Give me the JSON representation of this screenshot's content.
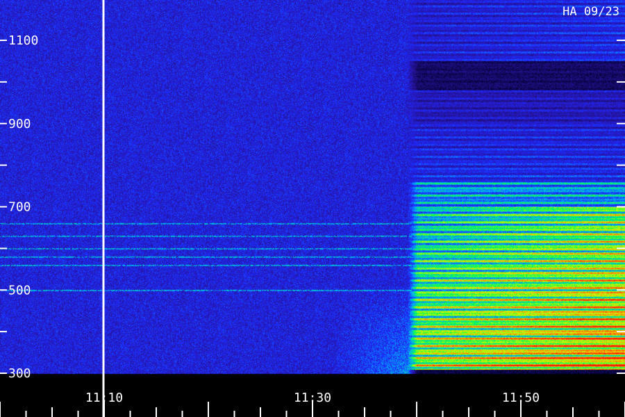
{
  "chart_data": {
    "type": "heatmap",
    "title": "HA 09/23",
    "xlabel": "",
    "ylabel": "",
    "x_tick_labels": [
      "11:10",
      "11:30",
      "11:50"
    ],
    "x_tick_values_minutes": [
      70,
      90,
      110
    ],
    "x_range_minutes": [
      60,
      120
    ],
    "y_tick_labels": [
      "1100",
      "900",
      "700",
      "500",
      "300"
    ],
    "y_tick_values": [
      1100,
      900,
      700,
      500,
      300
    ],
    "y_range": [
      300,
      1100
    ],
    "colormap": [
      "#000040",
      "#1a1aff",
      "#00c8ff",
      "#00ff40",
      "#ffff00",
      "#ff8000",
      "#ff0000"
    ],
    "marker_time_minutes": 70,
    "events": [
      {
        "name": "burst_onset",
        "start_minutes": 99.5,
        "freq_low": 300,
        "freq_high": 1160,
        "peak_intensity": 0.95
      }
    ],
    "narrowband_lines": [
      660,
      630,
      600,
      580,
      560,
      500
    ]
  },
  "colors": {
    "background": "#000000",
    "axis": "#ffffff",
    "marker_line": "#ffffff"
  }
}
